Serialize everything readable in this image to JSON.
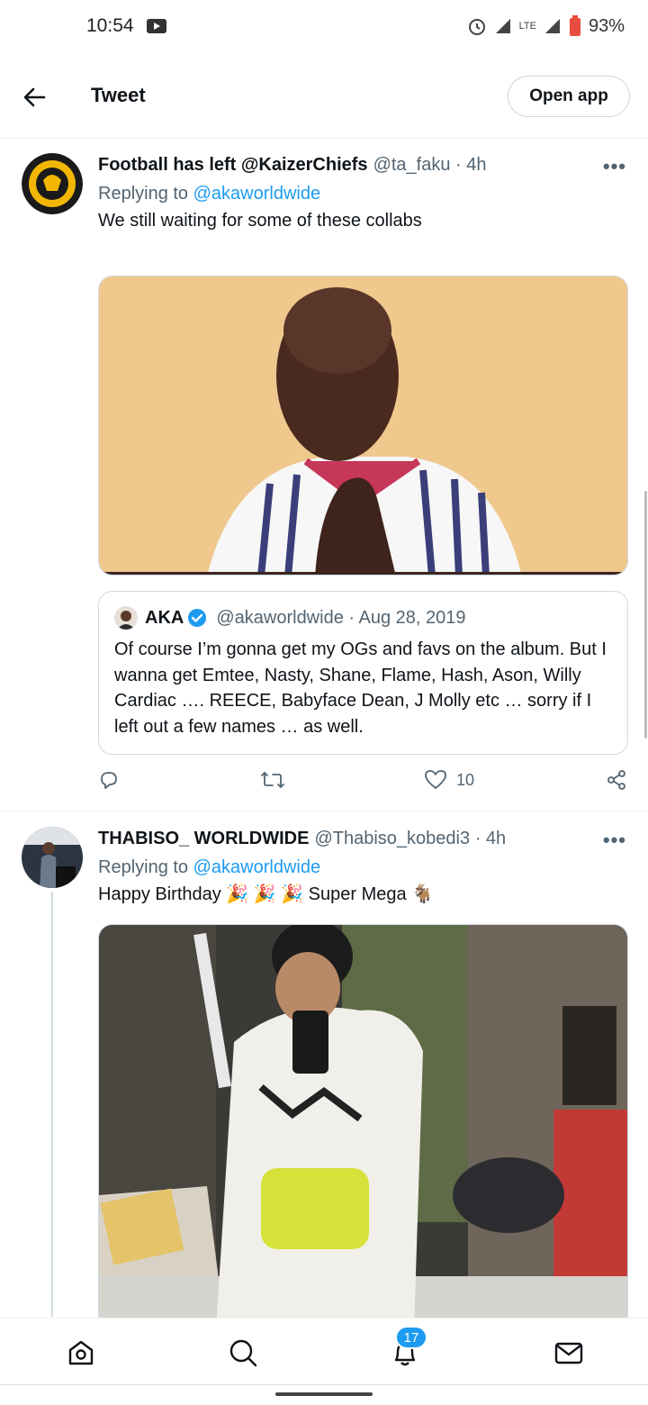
{
  "status_bar": {
    "time": "10:54",
    "battery": "93%",
    "network": "LTE"
  },
  "header": {
    "title": "Tweet",
    "open_app": "Open app"
  },
  "tweets": [
    {
      "display_name": "Football has left @KaizerChiefs",
      "handle_time": "@ta_faku · 4h",
      "replying_prefix": "Replying to ",
      "replying_to": "@akaworldwide",
      "text": "We still waiting for some of these collabs",
      "quote": {
        "display_name": "AKA",
        "handle_date": "@akaworldwide · Aug 28, 2019",
        "text": "Of course I’m gonna get my OGs and favs on the album. But I wanna get Emtee, Nasty, Shane, Flame, Hash, Ason, Willy Cardiac …. REECE, Babyface Dean, J Molly etc … sorry if I left out a few names … as well."
      },
      "likes": "10"
    },
    {
      "display_name": "THABISO_ WORLDWIDE",
      "handle_time": "@Thabiso_kobedi3 · 4h",
      "replying_prefix": "Replying to ",
      "replying_to": "@akaworldwide",
      "text": "Happy Birthday 🎉 🎉 🎉 Super Mega 🐐"
    }
  ],
  "bottom_nav": {
    "notification_count": "17"
  },
  "colors": {
    "accent": "#1d9bf0",
    "text": "#0f1419",
    "muted": "#536471"
  },
  "icons": [
    "back-arrow-icon",
    "more-icon",
    "reply-icon",
    "retweet-icon",
    "like-icon",
    "share-icon",
    "home-icon",
    "search-icon",
    "notifications-icon",
    "messages-icon",
    "verified-icon"
  ]
}
